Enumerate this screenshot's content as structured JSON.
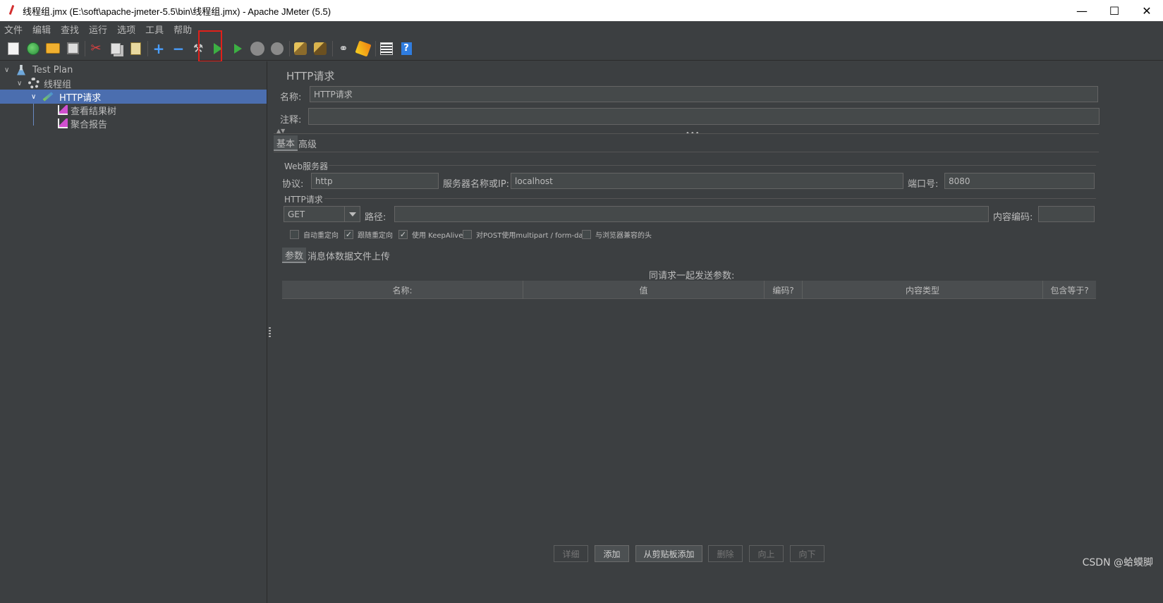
{
  "window": {
    "title": "线程组.jmx (E:\\soft\\apache-jmeter-5.5\\bin\\线程组.jmx) - Apache JMeter (5.5)",
    "minimize": "—",
    "maximize": "☐",
    "close": "✕"
  },
  "menu": [
    "文件",
    "编辑",
    "查找",
    "运行",
    "选项",
    "工具",
    "帮助"
  ],
  "toolbar": {
    "icons": [
      "new-icon",
      "templates-icon",
      "open-icon",
      "save-icon",
      "cut-icon",
      "copy-icon",
      "paste-icon",
      "expand-icon",
      "collapse-icon",
      "toggle-icon",
      "start-icon",
      "start-no-timers-icon",
      "stop-icon",
      "shutdown-icon",
      "clear-icon",
      "clear-all-icon",
      "search-icon",
      "reset-search-icon",
      "function-helper-icon",
      "help-icon"
    ],
    "highlight_color": "#e0201a"
  },
  "tree": {
    "items": [
      {
        "label": "Test Plan",
        "icon": "flask-icon"
      },
      {
        "label": "线程组",
        "icon": "gear-icon"
      },
      {
        "label": "HTTP请求",
        "icon": "pencil-icon",
        "selected": true
      },
      {
        "label": "查看结果树",
        "icon": "chart-icon"
      },
      {
        "label": "聚合报告",
        "icon": "chart-icon"
      }
    ],
    "selected_color": "#4b6eaf"
  },
  "panel": {
    "title": "HTTP请求",
    "name_label": "名称:",
    "name_value": "HTTP请求",
    "comment_label": "注释:",
    "comment_value": "",
    "tabs": [
      "基本",
      "高级"
    ],
    "web_server": {
      "group_title": "Web服务器",
      "protocol_label": "协议:",
      "protocol_value": "http",
      "server_label": "服务器名称或IP:",
      "server_value": "localhost",
      "port_label": "端口号:",
      "port_value": "8080"
    },
    "http_request": {
      "group_title": "HTTP请求",
      "method": "GET",
      "path_label": "路径:",
      "path_value": "",
      "encoding_label": "内容编码:",
      "encoding_value": ""
    },
    "checkboxes": [
      {
        "label": "自动重定向",
        "checked": false
      },
      {
        "label": "跟随重定向",
        "checked": true
      },
      {
        "label": "使用 KeepAlive",
        "checked": true
      },
      {
        "label": "对POST使用multipart / form-data",
        "checked": false
      },
      {
        "label": "与浏览器兼容的头",
        "checked": false
      }
    ],
    "sub_tabs": [
      "参数",
      "消息体数据",
      "文件上传"
    ],
    "params_caption": "同请求一起发送参数:",
    "table_headers": [
      "名称:",
      "值",
      "编码?",
      "内容类型",
      "包含等于?"
    ],
    "buttons": [
      {
        "label": "详细",
        "enabled": false
      },
      {
        "label": "添加",
        "enabled": true
      },
      {
        "label": "从剪贴板添加",
        "enabled": true
      },
      {
        "label": "删除",
        "enabled": false
      },
      {
        "label": "向上",
        "enabled": false
      },
      {
        "label": "向下",
        "enabled": false
      }
    ]
  },
  "watermark": "CSDN @蛤蟆脚"
}
